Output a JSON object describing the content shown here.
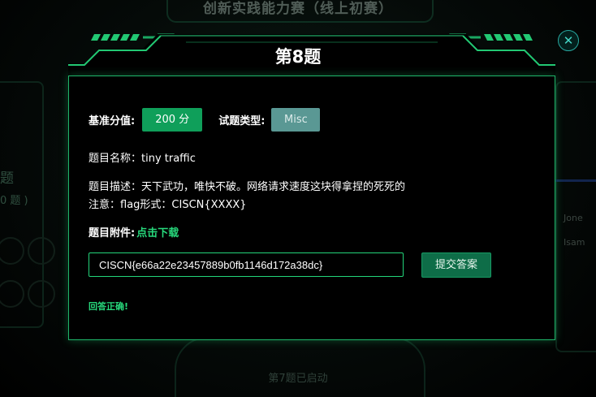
{
  "background": {
    "page_title": "创新实践能力赛（线上初赛）",
    "left_text_1": "题",
    "left_text_2": "0 题 )",
    "right_text_1": "Jone",
    "right_text_2": "Isam",
    "bottom_text": "第7题已启动"
  },
  "modal": {
    "title": "第8题",
    "close_glyph": "✕",
    "score_label": "基准分值:",
    "score_value": "200 分",
    "type_label": "试题类型:",
    "type_value": "Misc",
    "name_line": "题目名称：tiny traffic",
    "desc_line": "题目描述：天下武功，唯快不破。网络请求速度这块得拿捏的死死的",
    "note_line": "注意：flag形式：CISCN{XXXX}",
    "attachment_label": "题目附件:",
    "attachment_link": "点击下载",
    "flag_value": "CISCN{e66a22e23457889b0fb1146d172a38dc}",
    "submit_label": "提交答案",
    "result_message": "回答正确!"
  },
  "colors": {
    "accent_green": "#27d97c",
    "score_badge": "#0f9f5a",
    "type_badge": "#5a9894",
    "submit_button": "#0e6d48",
    "modal_border": "#1fb56a"
  }
}
